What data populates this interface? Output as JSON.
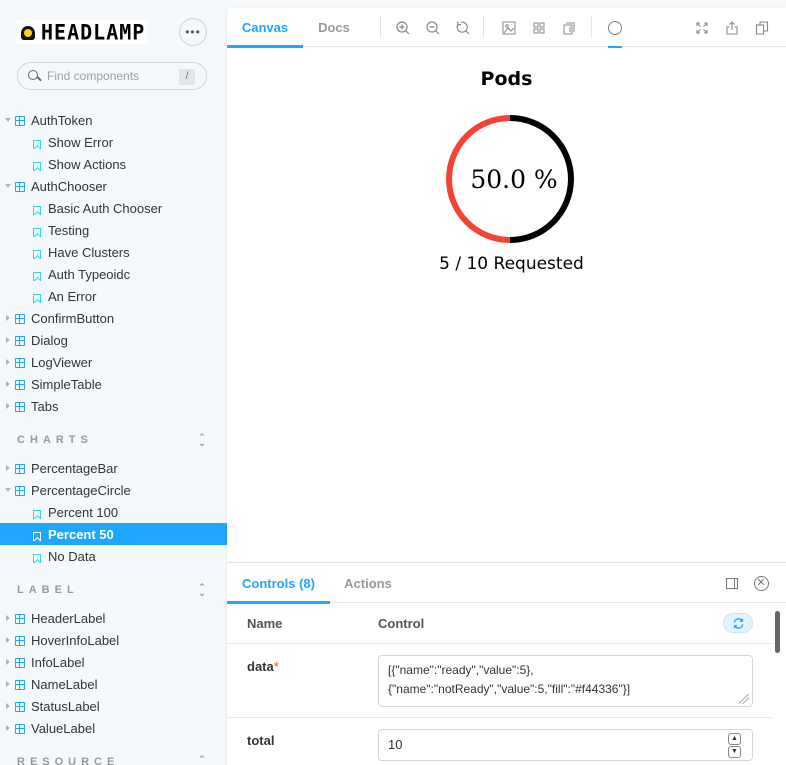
{
  "app": {
    "brand": "HEADLAMP",
    "more_label": "•••",
    "search": {
      "placeholder": "Find components",
      "value": "",
      "shortcut": "/"
    }
  },
  "sidebar": {
    "top_items": [
      {
        "label": "AuthToken",
        "type": "component",
        "expanded": true
      },
      {
        "label": "Show Error",
        "type": "story"
      },
      {
        "label": "Show Actions",
        "type": "story"
      },
      {
        "label": "AuthChooser",
        "type": "component",
        "expanded": true
      },
      {
        "label": "Basic Auth Chooser",
        "type": "story"
      },
      {
        "label": "Testing",
        "type": "story"
      },
      {
        "label": "Have Clusters",
        "type": "story"
      },
      {
        "label": "Auth Typeoidc",
        "type": "story"
      },
      {
        "label": "An Error",
        "type": "story"
      },
      {
        "label": "ConfirmButton",
        "type": "component",
        "expanded": false
      },
      {
        "label": "Dialog",
        "type": "component",
        "expanded": false
      },
      {
        "label": "LogViewer",
        "type": "component",
        "expanded": false
      },
      {
        "label": "SimpleTable",
        "type": "component",
        "expanded": false
      },
      {
        "label": "Tabs",
        "type": "component",
        "expanded": false
      }
    ],
    "sections": [
      {
        "title": "CHARTS",
        "items": [
          {
            "label": "PercentageBar",
            "type": "component",
            "expanded": false
          },
          {
            "label": "PercentageCircle",
            "type": "component",
            "expanded": true
          },
          {
            "label": "Percent 100",
            "type": "story"
          },
          {
            "label": "Percent 50",
            "type": "story",
            "selected": true
          },
          {
            "label": "No Data",
            "type": "story"
          }
        ]
      },
      {
        "title": "LABEL",
        "items": [
          {
            "label": "HeaderLabel",
            "type": "component",
            "expanded": false
          },
          {
            "label": "HoverInfoLabel",
            "type": "component",
            "expanded": false
          },
          {
            "label": "InfoLabel",
            "type": "component",
            "expanded": false
          },
          {
            "label": "NameLabel",
            "type": "component",
            "expanded": false
          },
          {
            "label": "StatusLabel",
            "type": "component",
            "expanded": false
          },
          {
            "label": "ValueLabel",
            "type": "component",
            "expanded": false
          }
        ]
      },
      {
        "title": "RESOURCE",
        "items": []
      }
    ]
  },
  "toolbar": {
    "tabs": [
      {
        "label": "Canvas",
        "active": true
      },
      {
        "label": "Docs",
        "active": false
      }
    ],
    "icons": [
      "zoom-in",
      "zoom-out",
      "zoom-reset",
      "background",
      "grid",
      "viewport",
      "outline",
      "fullscreen",
      "share",
      "copy-link"
    ]
  },
  "canvas": {
    "title": "Pods",
    "center_label": "50.0 %",
    "legend": "5 / 10 Requested"
  },
  "chart_data": {
    "type": "pie",
    "variant": "donut",
    "title": "Pods",
    "total": 10,
    "series": [
      {
        "name": "ready",
        "value": 5,
        "color": "#000000"
      },
      {
        "name": "notReady",
        "value": 5,
        "color": "#f44336"
      }
    ],
    "center_label": "50.0 %",
    "legend": "5 / 10 Requested"
  },
  "addons": {
    "tabs": [
      {
        "label": "Controls (8)",
        "active": true
      },
      {
        "label": "Actions",
        "active": false
      }
    ],
    "table": {
      "headers": {
        "name": "Name",
        "control": "Control"
      },
      "rows": [
        {
          "name": "data",
          "required": true,
          "required_mark": "*",
          "value_line1": "[{\"name\":\"ready\",\"value\":5},",
          "value_line2": "{\"name\":\"notReady\",\"value\":5,\"fill\":\"#f44336\"}]"
        },
        {
          "name": "total",
          "required": false,
          "value": "10"
        }
      ]
    }
  },
  "colors": {
    "accent": "#1ea7fd",
    "not_ready": "#f44336",
    "ready": "#000000",
    "story_icon": "#37d5d3"
  }
}
